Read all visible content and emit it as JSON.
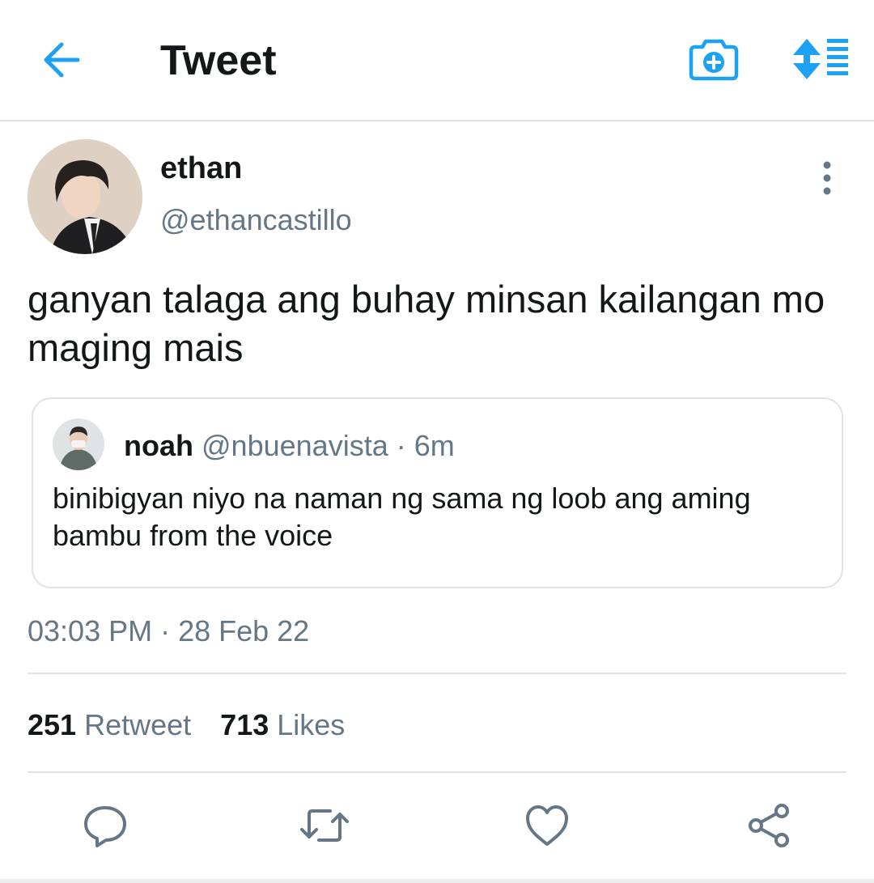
{
  "header": {
    "title": "Tweet",
    "back_icon": "arrow-left-icon",
    "camera_icon": "camera-plus-icon",
    "sort_icon": "sort-list-icon",
    "accent_color": "#1da1f2"
  },
  "tweet": {
    "author": {
      "name": "ethan",
      "handle": "@ethancastillo"
    },
    "text": "ganyan talaga ang buhay minsan kailangan mo maging mais",
    "timestamp": "03:03 PM · 28 Feb 22",
    "more_icon": "more-vertical-icon"
  },
  "quoted_tweet": {
    "name": "noah",
    "handle": "@nbuenavista",
    "time": "· 6m",
    "text": "binibigyan niyo na naman ng sama ng loob ang aming bambu from the voice"
  },
  "stats": {
    "retweets_count": "251",
    "retweets_label": "Retweet",
    "likes_count": "713",
    "likes_label": "Likes"
  },
  "actions": [
    {
      "icon": "reply-icon"
    },
    {
      "icon": "retweet-icon"
    },
    {
      "icon": "like-heart-icon"
    },
    {
      "icon": "share-icon"
    }
  ],
  "colors": {
    "text_primary": "#14171a",
    "text_secondary": "#657786",
    "divider": "#e1e4e7",
    "accent": "#1da1f2"
  }
}
